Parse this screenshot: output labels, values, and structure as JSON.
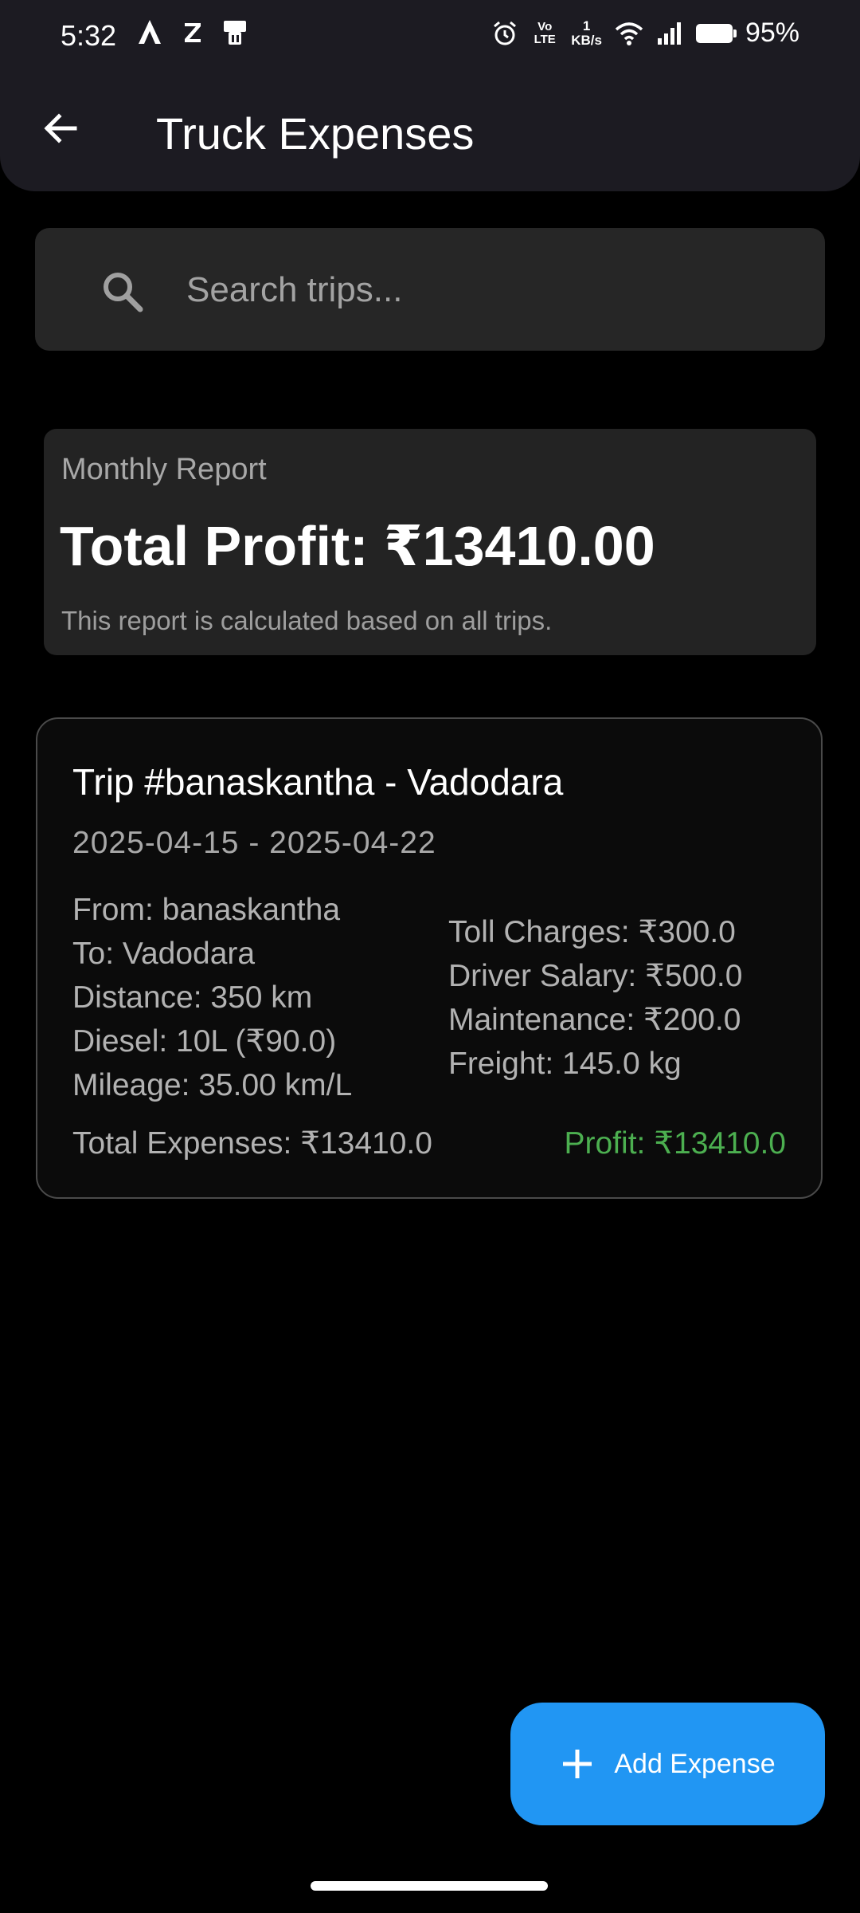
{
  "status_bar": {
    "time": "5:32",
    "volte": "Vo LTE",
    "net_speed_value": "1",
    "net_speed_unit": "KB/s",
    "battery_percent": "95%",
    "icons": [
      "a-app-icon",
      "z-app-icon",
      "sim-tool-icon",
      "alarm-icon",
      "volte-icon",
      "wifi-icon",
      "signal-icon",
      "battery-icon"
    ]
  },
  "app_bar": {
    "title": "Truck Expenses",
    "back_icon": "arrow-left-icon"
  },
  "search": {
    "placeholder": "Search trips...",
    "icon": "search-icon"
  },
  "report": {
    "label": "Monthly Report",
    "total": "Total Profit: ₹13410.00",
    "note": "This report is calculated based on all trips."
  },
  "trip": {
    "title": "Trip #banaskantha - Vadodara",
    "dates": "2025-04-15 - 2025-04-22",
    "from": "From: banaskantha",
    "to": "To: Vadodara",
    "distance": "Distance: 350 km",
    "diesel": "Diesel: 10L (₹90.0)",
    "mileage": "Mileage: 35.00 km/L",
    "toll": "Toll Charges: ₹300.0",
    "driver_salary": "Driver Salary: ₹500.0",
    "maintenance": "Maintenance: ₹200.0",
    "freight": "Freight: 145.0 kg",
    "total_expenses": "Total Expenses: ₹13410.0",
    "profit": "Profit: ₹13410.0",
    "profit_color": "#4caf50"
  },
  "fab": {
    "label": "Add Expense",
    "icon": "plus-icon",
    "color": "#2196f3"
  }
}
